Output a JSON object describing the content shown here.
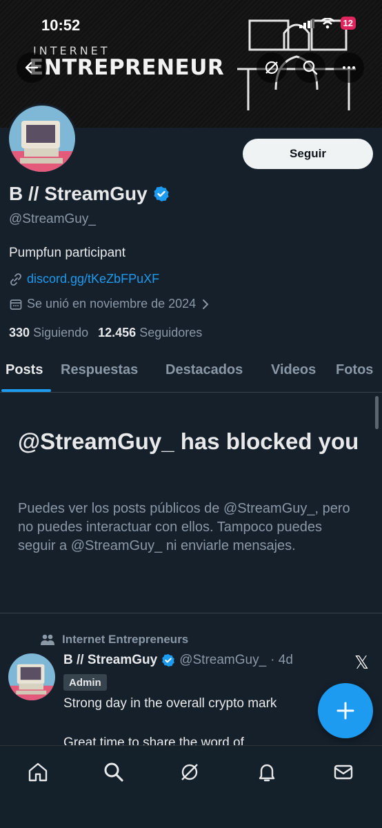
{
  "status_bar": {
    "time": "10:52",
    "battery": "12"
  },
  "banner": {
    "small_title": "INTERNET",
    "big_title": "ENTREPRENEUR"
  },
  "profile": {
    "follow_label": "Seguir",
    "display_name": "B // StreamGuy",
    "handle": "@StreamGuy_",
    "bio": "Pumpfun participant",
    "link": "discord.gg/tKeZbFPuXF",
    "joined": "Se unió en noviembre de 2024",
    "following_count": "330",
    "following_label": "Siguiendo",
    "followers_count": "12.456",
    "followers_label": "Seguidores"
  },
  "tabs": [
    {
      "label": "Posts",
      "active": true
    },
    {
      "label": "Respuestas"
    },
    {
      "label": "Destacados"
    },
    {
      "label": "Videos"
    },
    {
      "label": "Fotos"
    }
  ],
  "blocked": {
    "title": "@StreamGuy_ has blocked you",
    "description": "Puedes ver los posts públicos de @StreamGuy_, pero no puedes interactuar con ellos. Tampoco puedes seguir a @StreamGuy_ ni enviarle mensajes."
  },
  "post": {
    "community": "Internet Entrepreneurs",
    "author_name": "B // StreamGuy",
    "author_handle": "@StreamGuy_",
    "time": "· 4d",
    "badge": "Admin",
    "text_line1": "Strong day in the overall crypto mark",
    "text_line2": "Great time to share the word of"
  },
  "bottom_nav": [
    "home-icon",
    "search-icon",
    "grok-icon",
    "notifications-icon",
    "messages-icon"
  ],
  "colors": {
    "accent": "#1d9bf0",
    "background": "#15202b",
    "secondary_text": "#8b98a5"
  }
}
